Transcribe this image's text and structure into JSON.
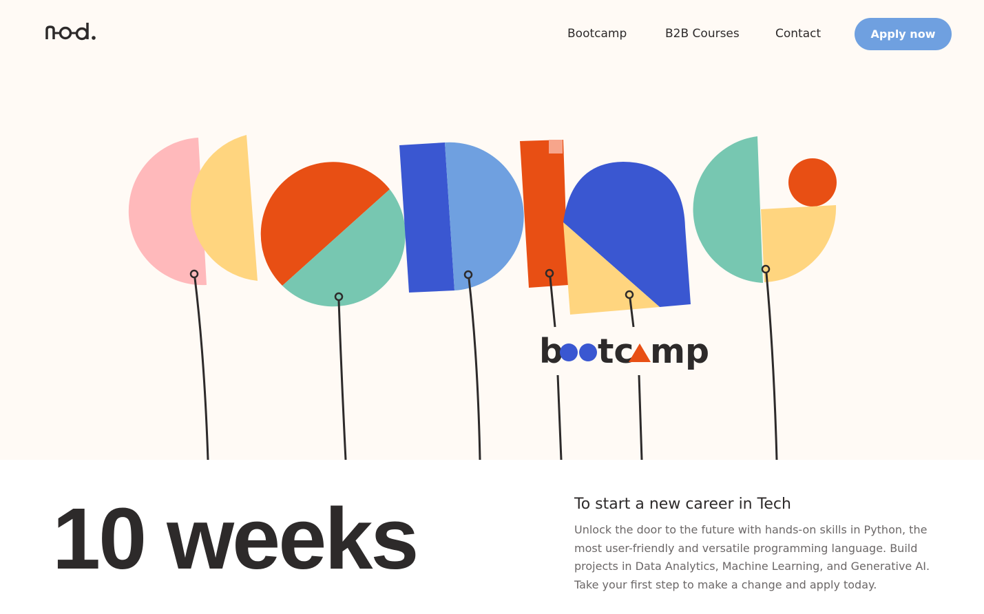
{
  "header": {
    "logo_text": "n-o-d.",
    "nav": [
      {
        "label": "Bootcamp"
      },
      {
        "label": "B2B Courses"
      },
      {
        "label": "Contact"
      }
    ],
    "cta_label": "Apply now"
  },
  "hero": {
    "wordmark": "bootcamp"
  },
  "intro": {
    "headline": "10 weeks",
    "subheading": "To start a new career in Tech",
    "body": "Unlock the door to the future with hands-on skills in Python, the most user-friendly and versatile programming language. Build projects in Data Analytics, Machine Learning, and Generative AI. Take your first step to make a change and apply today."
  },
  "colors": {
    "background": "#fffaf5",
    "pink": "#ffb9bb",
    "yellow": "#ffd57f",
    "orange": "#e84f14",
    "teal": "#77c7b1",
    "blue": "#3a57d1",
    "light_blue": "#6fa0e0",
    "peach": "#f7a58b",
    "ink": "#2d2a2a"
  },
  "icons": [
    "logo-icon"
  ]
}
